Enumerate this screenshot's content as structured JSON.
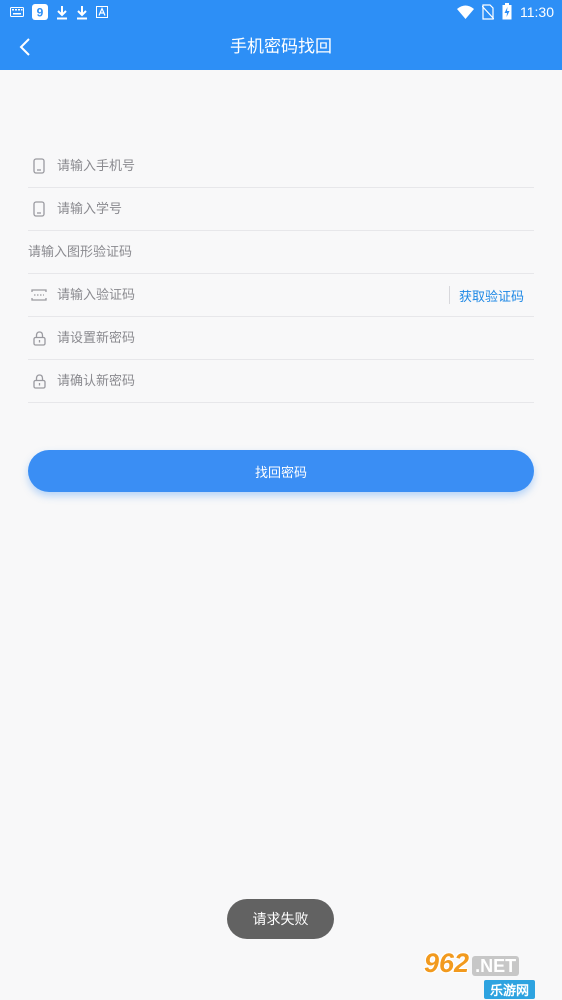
{
  "status_bar": {
    "time": "11:30",
    "icons_left": [
      "keyboard-icon",
      "app-notification-icon",
      "download-icon",
      "download-icon",
      "text-notification-icon"
    ],
    "icons_right": [
      "wifi-icon",
      "no-sim-icon",
      "battery-charging-icon"
    ]
  },
  "app_bar": {
    "title": "手机密码找回",
    "back_icon": "back-arrow-icon"
  },
  "form": {
    "phone_placeholder": "请输入手机号",
    "student_id_placeholder": "请输入学号",
    "captcha_placeholder": "请输入图形验证码",
    "sms_code_placeholder": "请输入验证码",
    "get_code_label": "获取验证码",
    "new_password_placeholder": "请设置新密码",
    "confirm_password_placeholder": "请确认新密码"
  },
  "submit_label": "找回密码",
  "toast": "请求失败",
  "watermark": {
    "logo": "962",
    "net": ".NET",
    "sub": "乐游网"
  },
  "colors": {
    "primary": "#2d8ff6",
    "button": "#3a8ef4",
    "link": "#1e88e5",
    "toast_bg": "#626262",
    "background": "#f8f8f9"
  }
}
